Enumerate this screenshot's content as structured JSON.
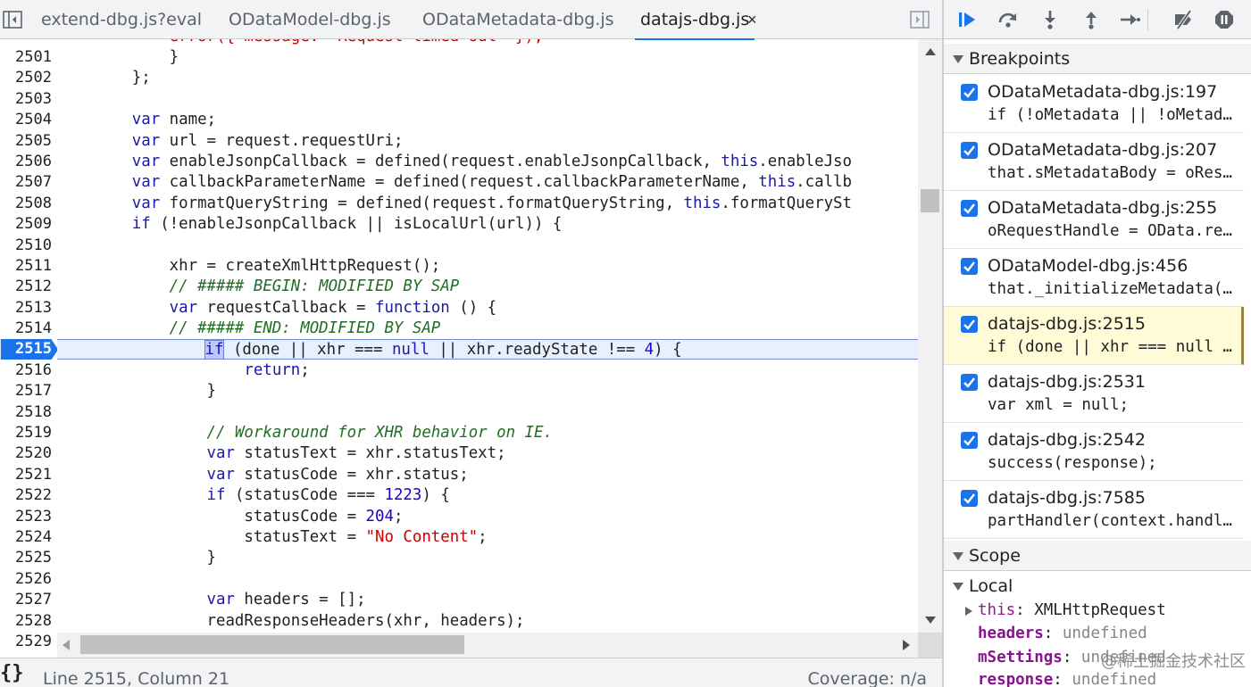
{
  "tabs": [
    {
      "label": "extend-dbg.js?eval",
      "active": false
    },
    {
      "label": "ODataModel-dbg.js",
      "active": false
    },
    {
      "label": "ODataMetadata-dbg.js",
      "active": false
    },
    {
      "label": "datajs-dbg.js",
      "active": true
    }
  ],
  "tab_close_glyph": "×",
  "editor": {
    "partial_top_line": "            error({ message: \"Request timed out\" });",
    "line_numbers": [
      "2501",
      "2502",
      "2503",
      "2504",
      "2505",
      "2506",
      "2507",
      "2508",
      "2509",
      "2510",
      "2511",
      "2512",
      "2513",
      "2514",
      "2515",
      "2516",
      "2517",
      "2518",
      "2519",
      "2520",
      "2521",
      "2522",
      "2523",
      "2524",
      "2525",
      "2526",
      "2527",
      "2528",
      "2529"
    ],
    "active_line": "2515",
    "lines": [
      "            }",
      "        };",
      "",
      "        var name;",
      "        var url = request.requestUri;",
      "        var enableJsonpCallback = defined(request.enableJsonpCallback, this.enableJso",
      "        var callbackParameterName = defined(request.callbackParameterName, this.callb",
      "        var formatQueryString = defined(request.formatQueryString, this.formatQuerySt",
      "        if (!enableJsonpCallback || isLocalUrl(url)) {",
      "",
      "            xhr = createXmlHttpRequest();",
      "            // ##### BEGIN: MODIFIED BY SAP",
      "            var requestCallback = function () {",
      "            // ##### END: MODIFIED BY SAP",
      "                if (done || xhr === null || xhr.readyState !== 4) {",
      "                    return;",
      "                }",
      "",
      "                // Workaround for XHR behavior on IE.",
      "                var statusText = xhr.statusText;",
      "                var statusCode = xhr.status;",
      "                if (statusCode === 1223) {",
      "                    statusCode = 204;",
      "                    statusText = \"No Content\";",
      "                }",
      "",
      "                var headers = [];",
      "                readResponseHeaders(xhr, headers);",
      ""
    ]
  },
  "status": {
    "braces": "{}",
    "position": "Line 2515, Column 21",
    "coverage": "Coverage: n/a"
  },
  "sections": {
    "breakpoints": "Breakpoints",
    "scope": "Scope"
  },
  "breakpoints": [
    {
      "file": "ODataMetadata-dbg.js:197",
      "code": "if (!oMetadata || !oMetadata.dataServices",
      "checked": true,
      "hit": false
    },
    {
      "file": "ODataMetadata-dbg.js:207",
      "code": "that.sMetadataBody = oResponse.body;",
      "checked": true,
      "hit": false
    },
    {
      "file": "ODataMetadata-dbg.js:255",
      "code": "oRequestHandle = OData.request(oRequest",
      "checked": true,
      "hit": false
    },
    {
      "file": "ODataModel-dbg.js:456",
      "code": "that._initializeMetadata(bSuppressEvents",
      "checked": true,
      "hit": false
    },
    {
      "file": "datajs-dbg.js:2515",
      "code": "if (done || xhr === null || xhr.readyState",
      "checked": true,
      "hit": true
    },
    {
      "file": "datajs-dbg.js:2531",
      "code": "var xml = null;",
      "checked": true,
      "hit": false
    },
    {
      "file": "datajs-dbg.js:2542",
      "code": "success(response);",
      "checked": true,
      "hit": false
    },
    {
      "file": "datajs-dbg.js:7585",
      "code": "partHandler(context.handler, parts",
      "checked": true,
      "hit": false
    }
  ],
  "scope": {
    "local_label": "Local",
    "rows": [
      {
        "key": "this",
        "value": "XMLHttpRequest",
        "expandable": true
      },
      {
        "key": "headers",
        "value": "undefined",
        "expandable": false
      },
      {
        "key": "mSettings",
        "value": "undefined",
        "expandable": false
      },
      {
        "key": "response",
        "value": "undefined",
        "expandable": false
      }
    ]
  },
  "watermark": "@稀土掘金技术社区",
  "colors": {
    "accent": "#1a73e8",
    "keyword": "#1a1aa6",
    "comment": "#236e25",
    "string": "#c80000",
    "number": "#1c00cf",
    "paused_bg": "#fffbd6"
  },
  "icons": {
    "left_toggle": "panel-left-icon",
    "right_toggle": "panel-right-icon",
    "resume": "resume-icon",
    "step_over": "step-over-icon",
    "step_into": "step-into-icon",
    "step_out": "step-out-icon",
    "step": "step-icon",
    "deactivate": "deactivate-breakpoints-icon",
    "pause_exceptions": "pause-on-exceptions-icon"
  }
}
